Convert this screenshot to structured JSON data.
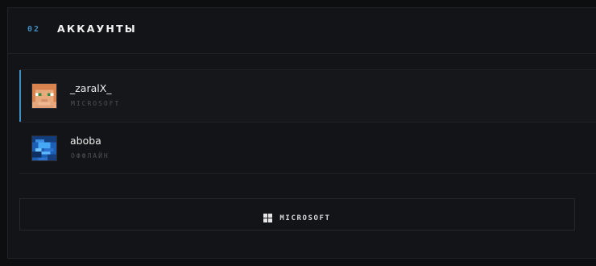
{
  "section": {
    "number": "02",
    "title": "АККАУНТЫ"
  },
  "accounts": [
    {
      "name": "_zaralX_",
      "type": "MICROSOFT",
      "active": true,
      "avatar": "orange-hair-skin-face"
    },
    {
      "name": "aboba",
      "type": "ОФФЛАЙН",
      "active": false,
      "avatar": "blue-skin-face"
    }
  ],
  "add_button": {
    "label": "MICROSOFT",
    "icon": "windows-logo-icon"
  },
  "colors": {
    "accent": "#3f8fc4",
    "background": "#0d0e10",
    "panel": "#131417"
  }
}
